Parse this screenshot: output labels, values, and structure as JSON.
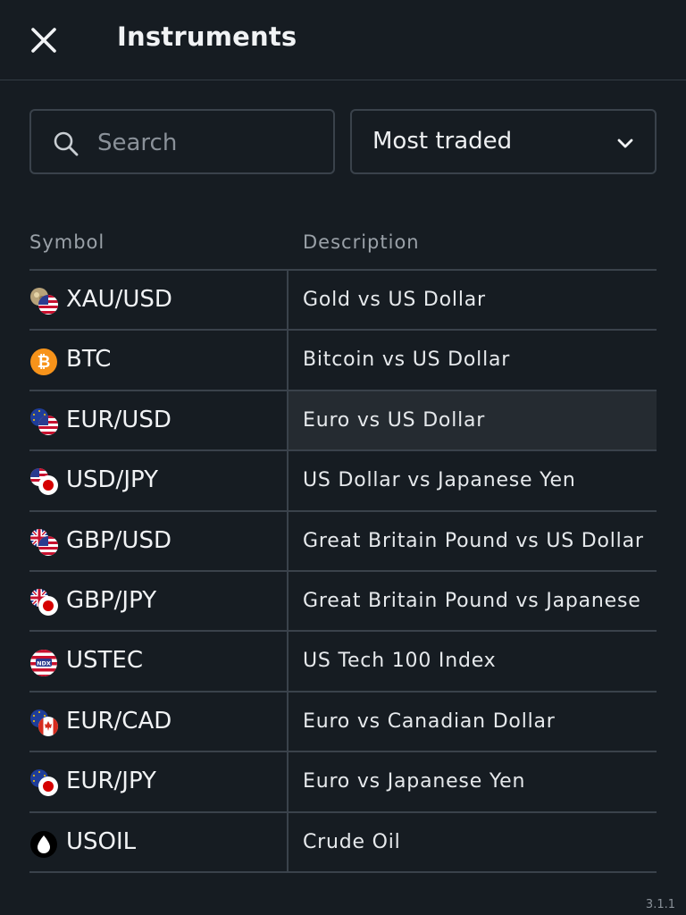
{
  "header": {
    "title": "Instruments",
    "close_icon": "close-icon"
  },
  "search": {
    "placeholder": "Search",
    "value": "",
    "icon": "search-icon"
  },
  "sort": {
    "selected": "Most traded",
    "icon": "chevron-down-icon"
  },
  "table": {
    "columns": [
      "Symbol",
      "Description"
    ],
    "rows": [
      {
        "symbol": "XAU/USD",
        "description": "Gold vs US Dollar",
        "icon": "gold-usd-icon"
      },
      {
        "symbol": "BTC",
        "description": "Bitcoin vs US Dollar",
        "icon": "bitcoin-icon"
      },
      {
        "symbol": "EUR/USD",
        "description": "Euro vs US Dollar",
        "icon": "eur-usd-flags-icon"
      },
      {
        "symbol": "USD/JPY",
        "description": "US Dollar vs Japanese Yen",
        "icon": "usd-jpy-flags-icon"
      },
      {
        "symbol": "GBP/USD",
        "description": "Great Britain Pound vs US Dollar",
        "icon": "gbp-usd-flags-icon"
      },
      {
        "symbol": "GBP/JPY",
        "description": "Great Britain Pound vs Japanese",
        "icon": "gbp-jpy-flags-icon"
      },
      {
        "symbol": "USTEC",
        "description": "US Tech 100 Index",
        "icon": "ndx-flag-icon"
      },
      {
        "symbol": "EUR/CAD",
        "description": "Euro vs Canadian Dollar",
        "icon": "eur-cad-flags-icon"
      },
      {
        "symbol": "EUR/JPY",
        "description": "Euro vs Japanese Yen",
        "icon": "eur-jpy-flags-icon"
      },
      {
        "symbol": "USOIL",
        "description": "Crude Oil",
        "icon": "oil-drop-icon"
      }
    ],
    "highlighted_row": 2
  },
  "footer": {
    "version": "3.1.1"
  },
  "colors": {
    "background": "#161c22",
    "border": "#3a424b",
    "text": "#e6e9ec",
    "muted": "#9aa1a8",
    "highlight": "#252b31",
    "bitcoin": "#f7931a"
  }
}
